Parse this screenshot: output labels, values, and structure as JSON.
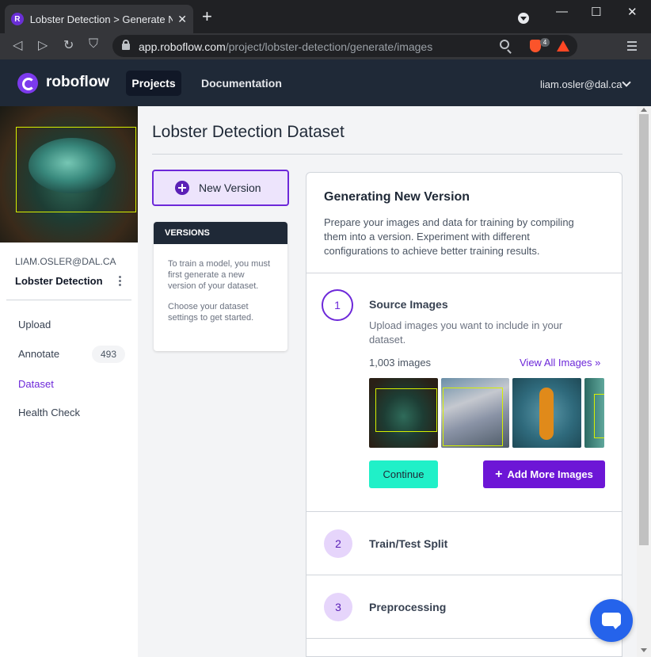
{
  "browser": {
    "tab_title": "Lobster Detection > Generate New Version",
    "tab_favicon": "R",
    "tab_close": "✕",
    "new_tab": "+",
    "url_host": "app.roboflow.com",
    "url_path": "/project/lobster-detection/generate/images",
    "shields_count": "4",
    "minimize": "—",
    "maximize": "☐",
    "close": "✕",
    "back": "◁",
    "forward": "▷",
    "reload": "↻",
    "bookmark": "⛉"
  },
  "header": {
    "logo_text": "roboflow",
    "nav_projects": "Projects",
    "nav_docs": "Documentation",
    "user_email": "liam.osler@dal.ca"
  },
  "sidebar": {
    "account": "LIAM.OSLER@DAL.CA",
    "project_name": "Lobster Detection",
    "items": [
      {
        "label": "Upload"
      },
      {
        "label": "Annotate",
        "count": "493"
      },
      {
        "label": "Dataset"
      },
      {
        "label": "Health Check"
      }
    ]
  },
  "main": {
    "page_title": "Lobster Detection Dataset",
    "new_version_label": "New Version",
    "versions_header": "VERSIONS",
    "versions_text_1": "To train a model, you must first generate a new version of your dataset.",
    "versions_text_2": "Choose your dataset settings to get started."
  },
  "generate": {
    "title": "Generating New Version",
    "description": "Prepare your images and data for training by compiling them into a version. Experiment with different configurations to achieve better training results.",
    "steps": [
      {
        "num": "1",
        "label": "Source Images",
        "description": "Upload images you want to include in your dataset."
      },
      {
        "num": "2",
        "label": "Train/Test Split"
      },
      {
        "num": "3",
        "label": "Preprocessing"
      }
    ],
    "image_count": "1,003 images",
    "view_all": "View All Images »",
    "continue_label": "Continue",
    "add_more_plus": "+",
    "add_more_label": "Add More Images"
  },
  "colors": {
    "accent": "#6d28d9",
    "continue_bg": "#20f0c8",
    "add_more_bg": "#6d16d6",
    "header_bg": "#1f2937",
    "chat_bg": "#2563eb"
  },
  "icons": [
    "search-icon",
    "lock-icon",
    "brave-shield-icon",
    "bat-icon",
    "menu-icon",
    "chevron-down-icon",
    "plus-circle-icon",
    "kebab-icon",
    "chat-icon"
  ]
}
